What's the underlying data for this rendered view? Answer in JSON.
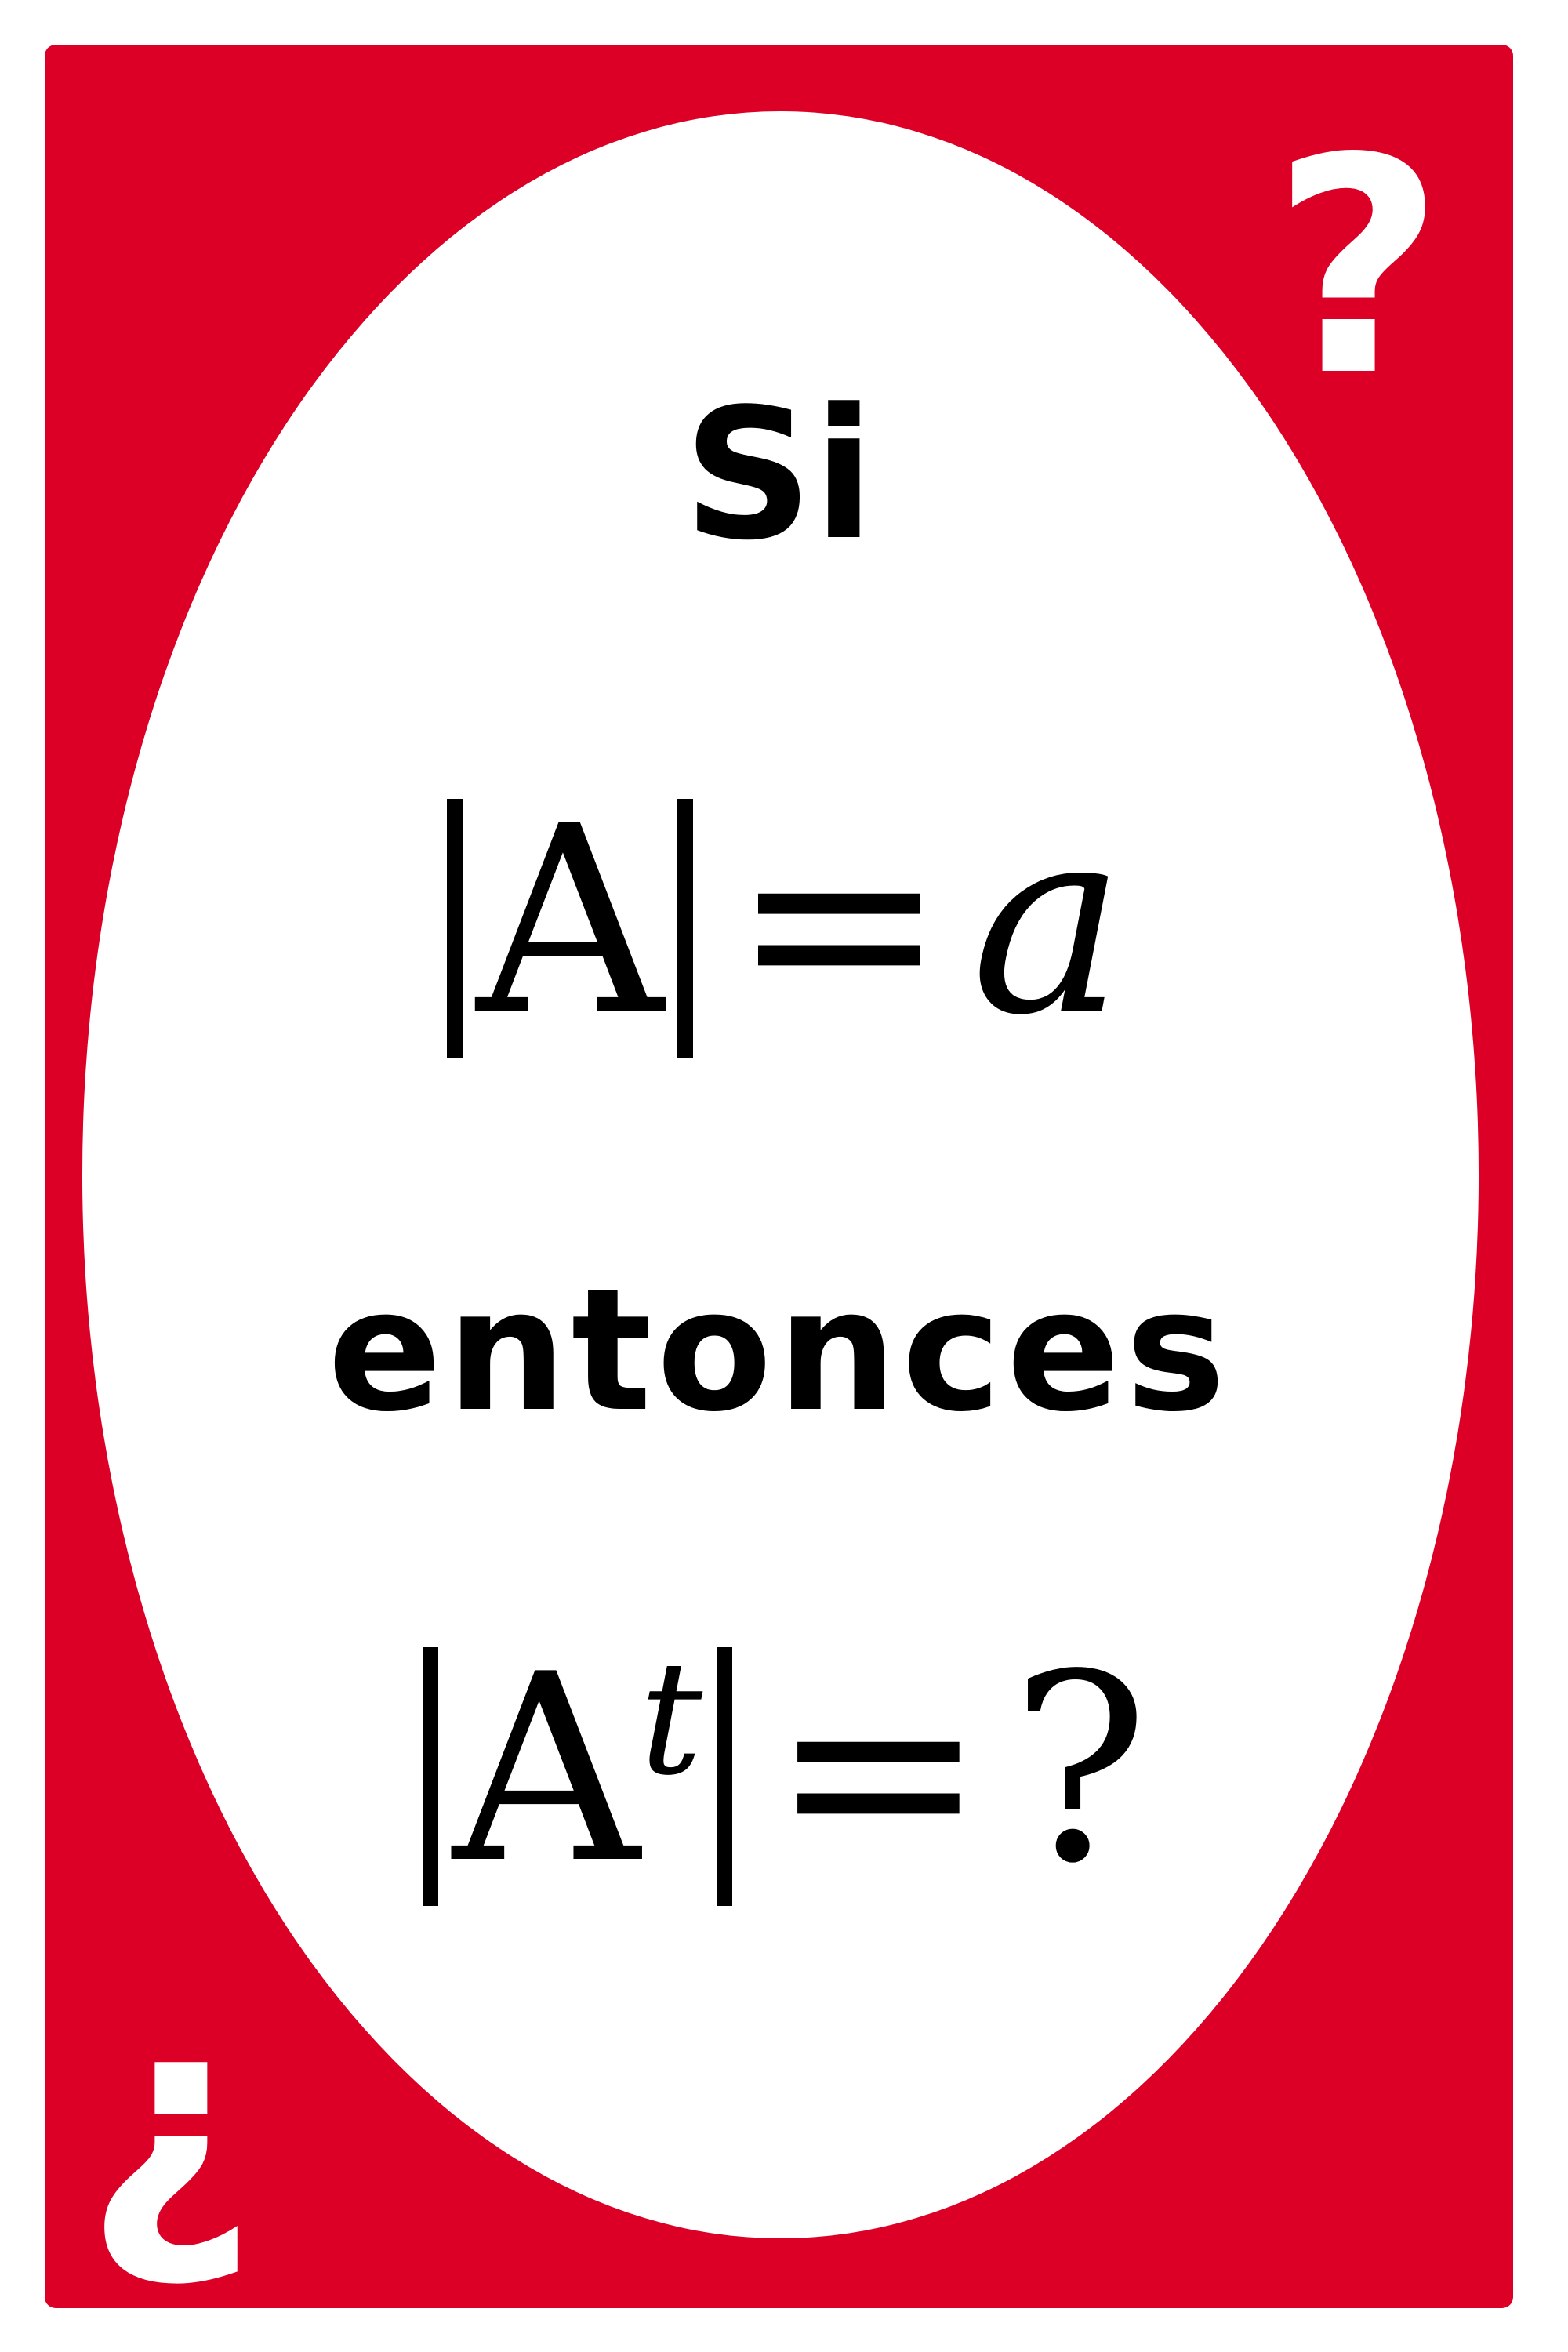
{
  "card": {
    "colors": {
      "background": "#dc0026",
      "oval": "#ffffff",
      "text": "#000000",
      "corner_glyph": "#ffffff"
    },
    "corner_top_right": "?",
    "corner_bottom_left": "¿",
    "line1": "Si",
    "equation1": {
      "matrix": "A",
      "equals": "=",
      "rhs": "a"
    },
    "line3": "entonces",
    "equation2": {
      "matrix": "A",
      "superscript": "t",
      "equals": "=",
      "rhs": "?"
    }
  }
}
